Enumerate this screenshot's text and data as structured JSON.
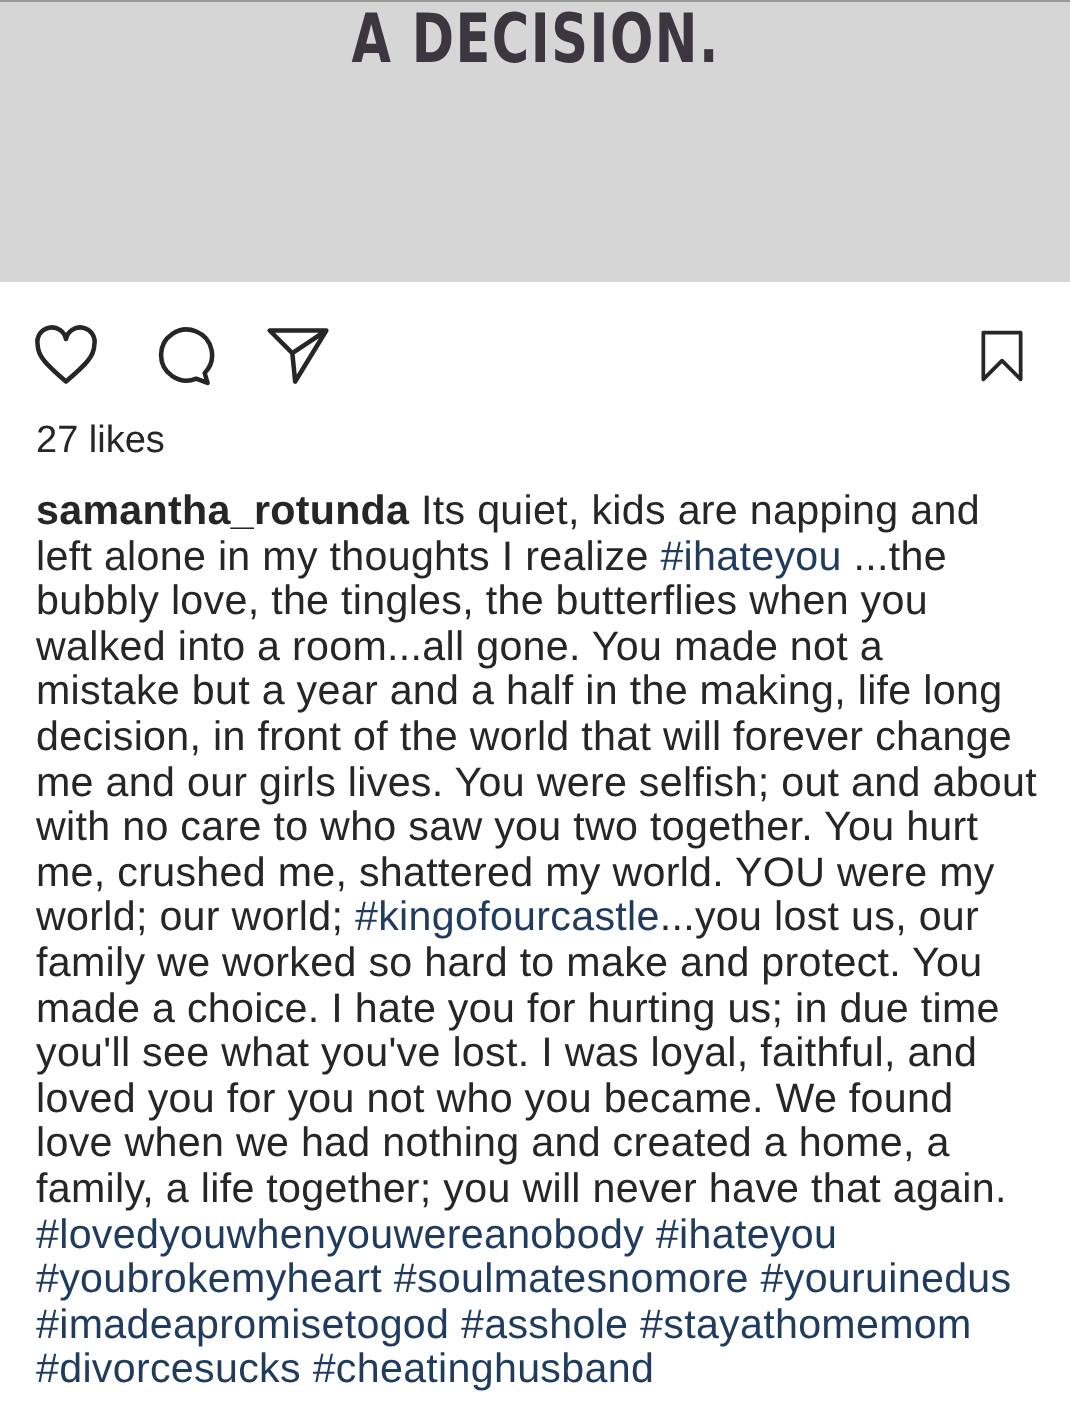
{
  "post_image": {
    "headline": "A DECISION."
  },
  "actions": [
    {
      "kind": "like"
    },
    {
      "kind": "comment"
    },
    {
      "kind": "share"
    },
    {
      "kind": "save"
    }
  ],
  "likes": "27 likes",
  "caption": [
    {
      "kind": "username",
      "text": "samantha_rotunda"
    },
    {
      "kind": "text",
      "text": " Its quiet, kids are napping and left alone in my thoughts I realize "
    },
    {
      "kind": "hashtag",
      "text": "#ihateyou"
    },
    {
      "kind": "text",
      "text": " ...the bubbly love, the tingles, the butterflies when you walked into a room...all gone. You made not a mistake but a year and a half in the making, life long decision, in front of the world that will forever change me and our girls lives. You were selfish; out and about with no care to who saw you two together. You hurt me, crushed me, shattered my world. YOU were my world; our world; "
    },
    {
      "kind": "hashtag",
      "text": "#kingofourcastle"
    },
    {
      "kind": "text",
      "text": "...you lost us, our family we worked so hard to make and protect. You made a choice. I hate you for hurting us; in due time you'll see what you've lost. I was loyal, faithful, and loved you for you not who you became. We found love when we had nothing and created a home, a family, a life together; you will never have that again. "
    },
    {
      "kind": "hashtag",
      "text": "#lovedyouwhenyouwereanobody"
    },
    {
      "kind": "hashtag",
      "text": "#ihateyou"
    },
    {
      "kind": "hashtag",
      "text": "#youbrokemyheart"
    },
    {
      "kind": "hashtag",
      "text": "#soulmatesnomore"
    },
    {
      "kind": "hashtag",
      "text": "#youruinedus"
    },
    {
      "kind": "hashtag",
      "text": "#imadeapromisetogod"
    },
    {
      "kind": "hashtag",
      "text": "#asshole"
    },
    {
      "kind": "hashtag",
      "text": "#stayathomemom"
    },
    {
      "kind": "hashtag",
      "text": "#divorcesucks"
    },
    {
      "kind": "hashtag",
      "text": "#cheatinghusband"
    }
  ]
}
